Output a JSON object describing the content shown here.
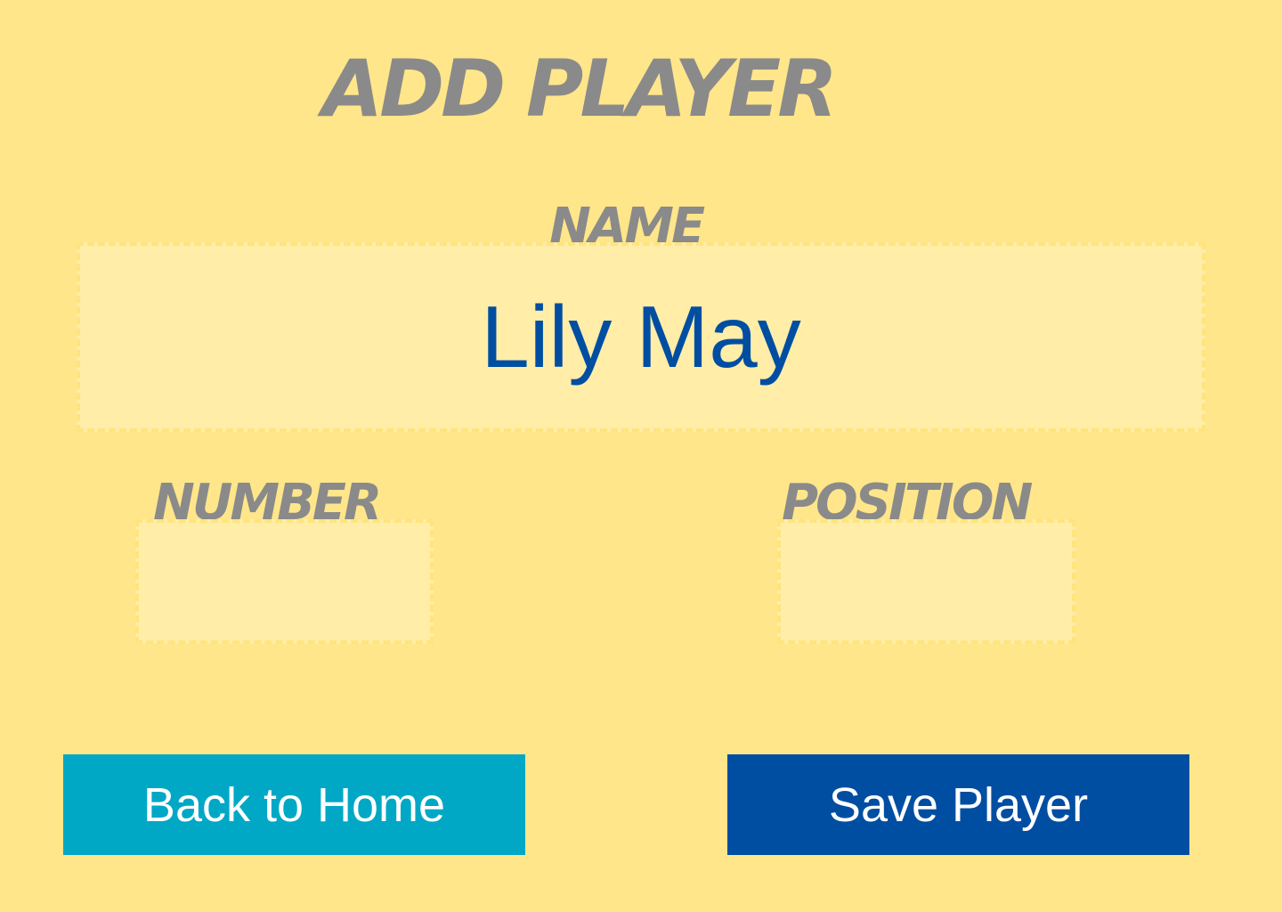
{
  "page": {
    "title": "ADD PLAYER"
  },
  "form": {
    "name": {
      "label": "NAME",
      "value": "Lily May"
    },
    "number": {
      "label": "NUMBER",
      "value": ""
    },
    "position": {
      "label": "POSITION",
      "value": ""
    }
  },
  "buttons": {
    "back_label": "Back to Home",
    "save_label": "Save Player"
  },
  "colors": {
    "background": "#FFE68A",
    "field_fill": "#FFEDA8",
    "label_gray": "#8A8A8A",
    "value_blue": "#004EA2",
    "back_button": "#00A8C6",
    "save_button": "#004EA2"
  }
}
